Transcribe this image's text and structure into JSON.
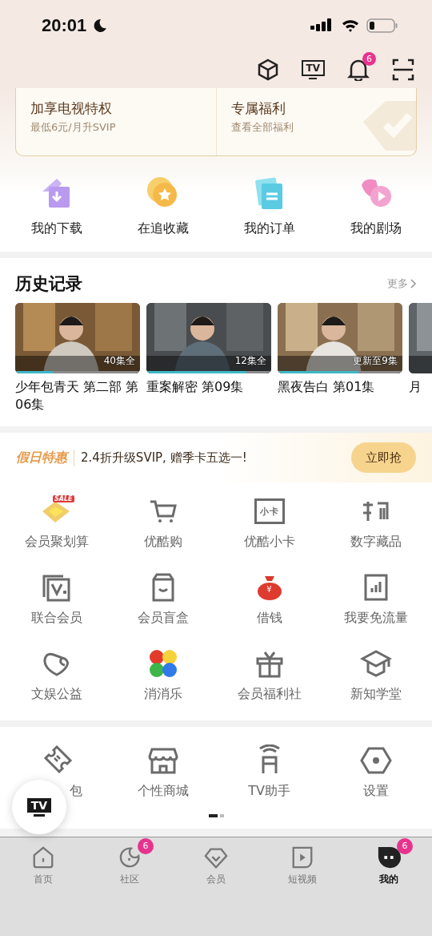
{
  "status_bar": {
    "time": "20:01"
  },
  "header": {
    "tv_icon_text": "TV",
    "notification_badge": "6"
  },
  "vip_card": {
    "left": {
      "title": "加享电视特权",
      "subtitle": "最低6元/月升SVIP"
    },
    "right": {
      "title": "专属福利",
      "subtitle": "查看全部福利"
    }
  },
  "quick_entries": [
    {
      "kind": "download",
      "label": "我的下载"
    },
    {
      "kind": "favorite",
      "label": "在追收藏"
    },
    {
      "kind": "order",
      "label": "我的订单"
    },
    {
      "kind": "theater",
      "label": "我的剧场"
    }
  ],
  "history": {
    "title": "历史记录",
    "more": "更多",
    "items": [
      {
        "title": "少年包青天 第二部 第06集",
        "badge": "40集全",
        "level": 0.3
      },
      {
        "title": "重案解密 第09集",
        "badge": "12集全",
        "level": 0.8
      },
      {
        "title": "黑夜告白 第01集",
        "badge": "更新至9集",
        "level": 0.65
      },
      {
        "title": "月"
      }
    ]
  },
  "promo": {
    "tag": "假日特惠",
    "text": "2.4折升级SVIP, 赠季卡五选一!",
    "button": "立即抢"
  },
  "services": [
    {
      "kind": "sale",
      "label": "会员聚划算",
      "icon_text": "SALE"
    },
    {
      "kind": "cart",
      "label": "优酷购"
    },
    {
      "kind": "card",
      "label": "优酷小卡",
      "icon_text": "小卡"
    },
    {
      "kind": "digital",
      "label": "数字藏品"
    },
    {
      "kind": "vplus",
      "label": "联合会员"
    },
    {
      "kind": "box",
      "label": "会员盲盒"
    },
    {
      "kind": "moneybag",
      "label": "借钱",
      "icon_text": "¥"
    },
    {
      "kind": "chart",
      "label": "我要免流量"
    },
    {
      "kind": "heart",
      "label": "文娱公益"
    },
    {
      "kind": "game",
      "label": "消消乐"
    },
    {
      "kind": "gift",
      "label": "会员福利社"
    },
    {
      "kind": "cap",
      "label": "新知学堂"
    }
  ],
  "tools": {
    "items": [
      {
        "kind": "ticket",
        "label": "包"
      },
      {
        "kind": "store",
        "label": "个性商城"
      },
      {
        "kind": "remote",
        "label": "TV助手"
      },
      {
        "kind": "settings",
        "label": "设置"
      }
    ],
    "pages": [
      {
        "selected": true
      },
      {
        "selected": false
      }
    ]
  },
  "floating_tv": {
    "text": "TV"
  },
  "tabs": [
    {
      "kind": "home",
      "label": "首页",
      "selected": false
    },
    {
      "kind": "community",
      "label": "社区",
      "selected": false,
      "badge": "6"
    },
    {
      "kind": "vip",
      "label": "会员",
      "selected": false
    },
    {
      "kind": "video",
      "label": "短视频",
      "selected": false
    },
    {
      "kind": "mine",
      "label": "我的",
      "selected": true,
      "badge": "6"
    }
  ]
}
